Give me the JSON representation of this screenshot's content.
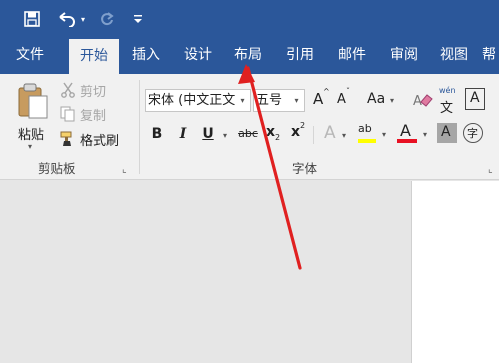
{
  "quick_access": {
    "save_icon": "save-icon",
    "undo_icon": "undo-icon",
    "redo_icon": "redo-icon",
    "customize_icon": "customize-qat-icon"
  },
  "tabs": [
    {
      "label": "文件"
    },
    {
      "label": "开始",
      "active": true
    },
    {
      "label": "插入"
    },
    {
      "label": "设计"
    },
    {
      "label": "布局"
    },
    {
      "label": "引用"
    },
    {
      "label": "邮件"
    },
    {
      "label": "审阅"
    },
    {
      "label": "视图"
    },
    {
      "label": "帮"
    }
  ],
  "clipboard": {
    "paste_label": "粘贴",
    "cut_label": "剪切",
    "copy_label": "复制",
    "format_painter_label": "格式刷",
    "group_label": "剪贴板"
  },
  "font": {
    "font_name": "宋体 (中文正文",
    "font_size": "五号",
    "grow_label": "A",
    "shrink_label": "A",
    "case_label": "Aa",
    "phonetic_top": "wén",
    "phonetic_bottom": "文",
    "border_label": "A",
    "bold_label": "B",
    "italic_label": "I",
    "underline_label": "U",
    "strike_label": "abc",
    "subscript_base": "x",
    "subscript_mark": "2",
    "superscript_base": "x",
    "superscript_mark": "2",
    "effects_label": "A",
    "highlight_label": "ab",
    "font_color_label": "A",
    "shading_label": "A",
    "enclose_label": "字",
    "group_label": "字体"
  },
  "colors": {
    "title_bar": "#2b579a",
    "ribbon": "#f1f1f1",
    "highlight": "#ffff00",
    "font_color": "#e81123",
    "annotation_arrow": "#e02020"
  }
}
